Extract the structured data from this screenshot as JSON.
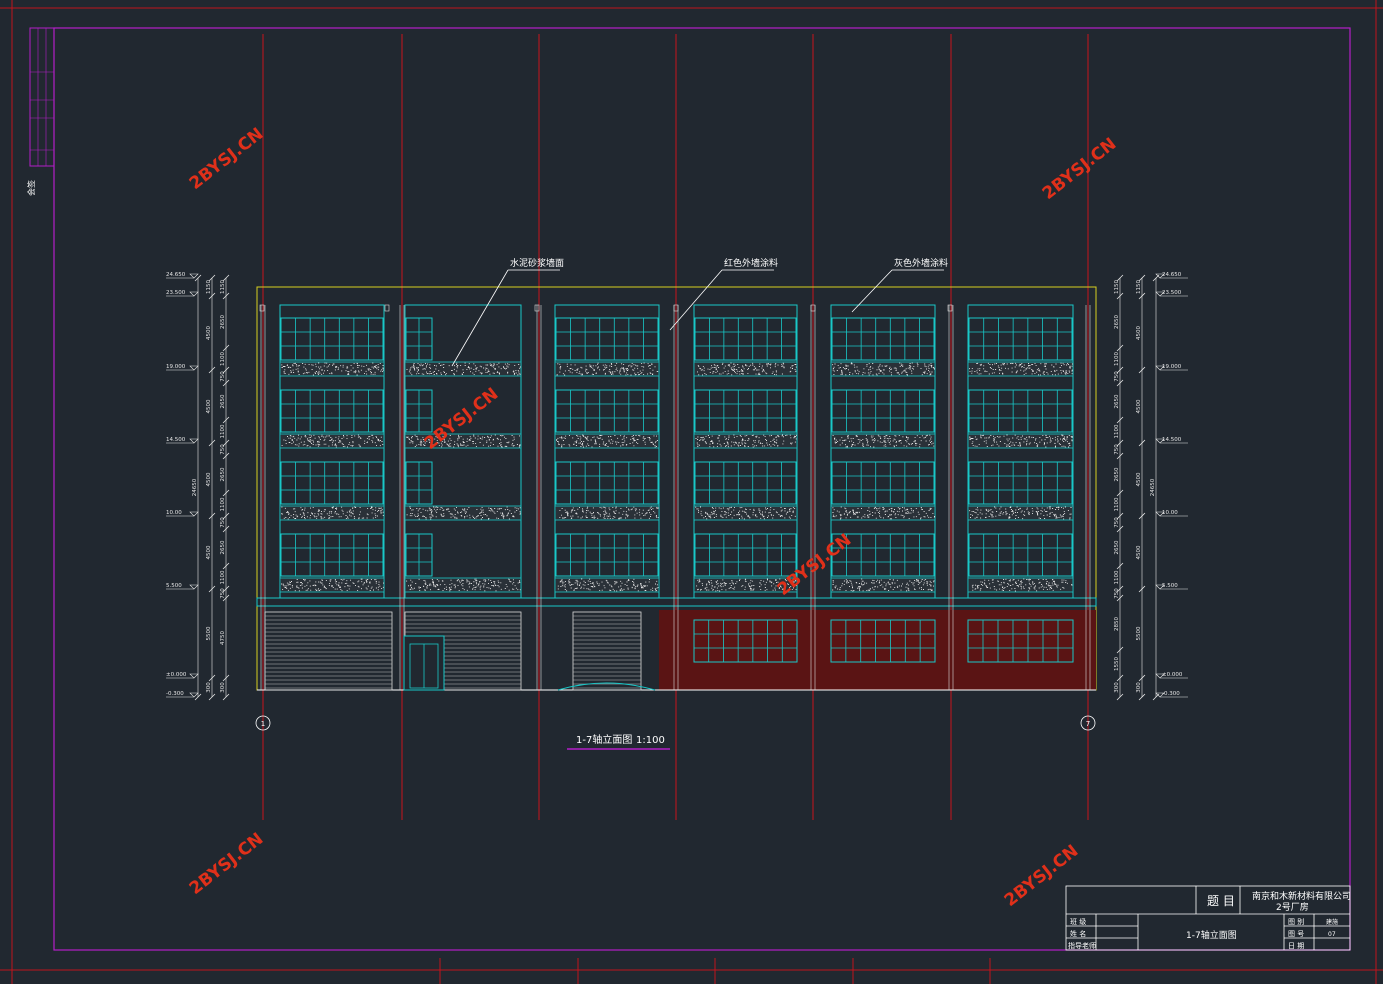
{
  "drawing": {
    "view_title": "1-7轴立面图",
    "view_scale": "1:100",
    "callouts": {
      "cement": "水泥砂浆墙面",
      "red_paint": "红色外墙涂料",
      "grey_paint": "灰色外墙涂料"
    },
    "axes": {
      "left": "1",
      "right": "7"
    },
    "left_elevations": [
      "24.650",
      "23.500",
      "19.000",
      "14.500",
      "10.00",
      "5.500",
      "±0.000",
      "-0.300"
    ],
    "right_elevations": [
      "24.650",
      "23.500",
      "19.000",
      "14.500",
      "10.00",
      "5.500",
      "±0.000",
      "-0.300"
    ],
    "dims_left_outer": [
      "24650"
    ],
    "dims_left_mid": [
      "1150",
      "4500",
      "4500",
      "4500",
      "4500",
      "5500",
      "300"
    ],
    "dims_left_inner": [
      "1150",
      "2650",
      "1100",
      "750",
      "2650",
      "1100",
      "750",
      "2650",
      "1100",
      "750",
      "2650",
      "1100",
      "750",
      "4750",
      "300"
    ],
    "dims_right_outer": [
      "24650"
    ],
    "dims_right_mid": [
      "1150",
      "4500",
      "4500",
      "4500",
      "4500",
      "5500",
      "300"
    ],
    "dims_right_inner": [
      "1150",
      "2650",
      "1100",
      "750",
      "2650",
      "1100",
      "750",
      "2650",
      "1100",
      "750",
      "2650",
      "1100",
      "750",
      "2850",
      "1550",
      "300"
    ],
    "watermark": "2BYSJ.CN",
    "side_note": "会签"
  },
  "title_block": {
    "title_label": "题 目",
    "company": "南京和木新材料有限公司",
    "project": "2号厂房",
    "row_labels": [
      "班 级",
      "姓 名",
      "指导老师"
    ],
    "drawing_name": "1-7轴立面图",
    "field_labels": [
      "图 别",
      "图 号",
      "日 期"
    ],
    "field_values": [
      "建施",
      "07",
      ""
    ]
  }
}
